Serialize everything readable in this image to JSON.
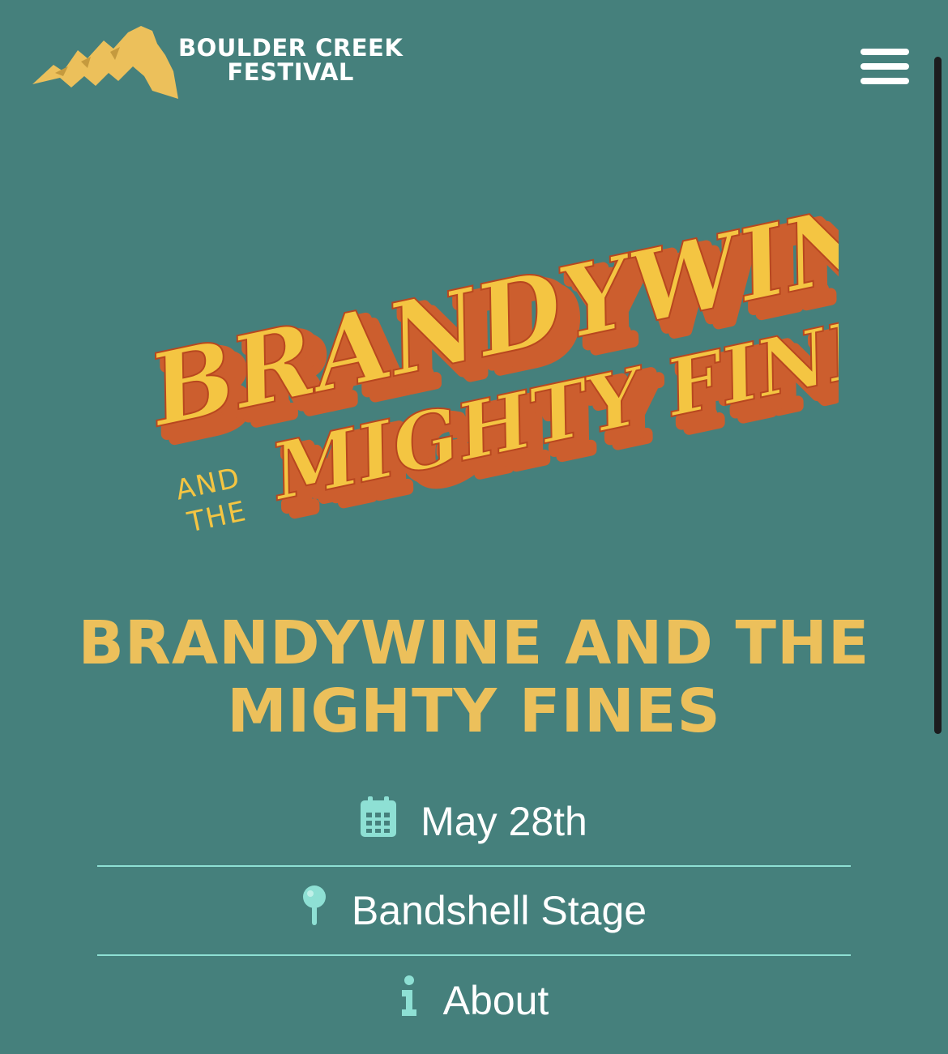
{
  "header": {
    "logo_line1": "BOULDER CREEK",
    "logo_line2": "FESTIVAL",
    "menu_icon": "hamburger-menu-icon"
  },
  "artwork": {
    "line1": "BRANDYWINE",
    "small_and": "AND",
    "small_the": "THE",
    "line2": "MIGHTY FINES"
  },
  "event": {
    "title": "BRANDYWINE AND THE MIGHTY FINES",
    "date": "May 28th",
    "location": "Bandshell Stage",
    "about_label": "About"
  },
  "colors": {
    "background": "#45807c",
    "accent_gold": "#ecc05b",
    "artwork_orange": "#cc5e2e",
    "icon_mint": "#8ee0d4"
  },
  "icons": {
    "date": "calendar-icon",
    "location": "map-pin-icon",
    "about": "info-icon"
  }
}
